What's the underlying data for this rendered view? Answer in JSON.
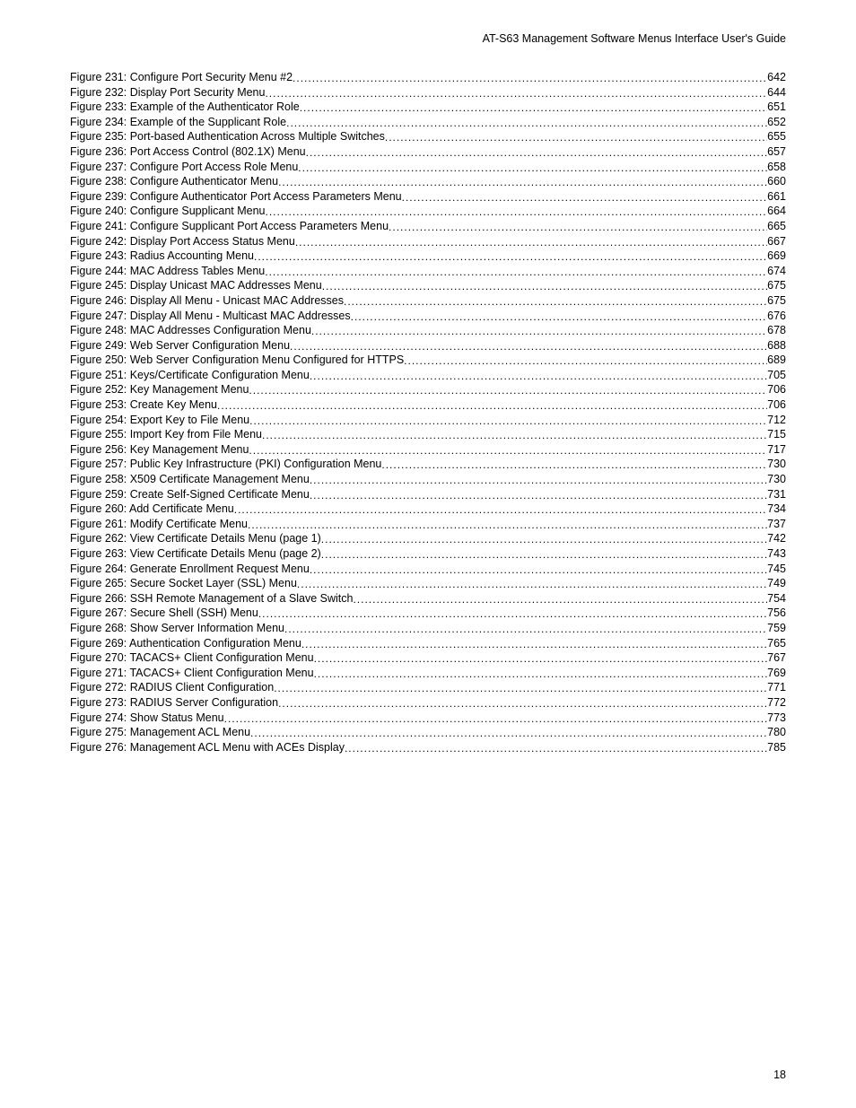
{
  "header": "AT-S63 Management Software Menus Interface User's Guide",
  "page_number": "18",
  "entries": [
    {
      "label": "Figure 231: Configure Port Security Menu #2",
      "page": "642"
    },
    {
      "label": "Figure 232: Display Port Security Menu",
      "page": "644"
    },
    {
      "label": "Figure 233: Example of the Authenticator Role",
      "page": "651"
    },
    {
      "label": "Figure 234: Example of the Supplicant Role",
      "page": "652"
    },
    {
      "label": "Figure 235: Port-based Authentication Across Multiple Switches",
      "page": "655"
    },
    {
      "label": "Figure 236: Port Access Control (802.1X) Menu",
      "page": "657"
    },
    {
      "label": "Figure 237: Configure Port Access Role Menu",
      "page": "658"
    },
    {
      "label": "Figure 238: Configure Authenticator Menu",
      "page": "660"
    },
    {
      "label": "Figure 239: Configure Authenticator Port Access Parameters Menu",
      "page": "661"
    },
    {
      "label": "Figure 240: Configure Supplicant Menu",
      "page": "664"
    },
    {
      "label": "Figure 241: Configure Supplicant Port Access Parameters Menu",
      "page": "665"
    },
    {
      "label": "Figure 242: Display Port Access Status Menu",
      "page": "667"
    },
    {
      "label": "Figure 243: Radius Accounting Menu",
      "page": "669"
    },
    {
      "label": "Figure 244: MAC Address Tables Menu",
      "page": "674"
    },
    {
      "label": "Figure 245: Display Unicast MAC Addresses Menu",
      "page": "675"
    },
    {
      "label": "Figure 246: Display All Menu - Unicast MAC Addresses",
      "page": "675"
    },
    {
      "label": "Figure 247: Display All Menu - Multicast MAC Addresses",
      "page": "676"
    },
    {
      "label": "Figure 248: MAC Addresses Configuration Menu",
      "page": "678"
    },
    {
      "label": "Figure 249: Web Server Configuration Menu",
      "page": "688"
    },
    {
      "label": "Figure 250: Web Server Configuration Menu Configured for HTTPS",
      "page": "689"
    },
    {
      "label": "Figure 251: Keys/Certificate Configuration Menu",
      "page": "705"
    },
    {
      "label": "Figure 252: Key Management Menu",
      "page": "706"
    },
    {
      "label": "Figure 253: Create Key Menu",
      "page": "706"
    },
    {
      "label": "Figure 254: Export Key to File Menu",
      "page": "712"
    },
    {
      "label": "Figure 255: Import Key from File Menu",
      "page": "715"
    },
    {
      "label": "Figure 256: Key Management Menu",
      "page": "717"
    },
    {
      "label": "Figure 257: Public Key Infrastructure (PKI) Configuration Menu",
      "page": "730"
    },
    {
      "label": "Figure 258: X509 Certificate Management Menu",
      "page": "730"
    },
    {
      "label": "Figure 259: Create Self-Signed Certificate Menu",
      "page": "731"
    },
    {
      "label": "Figure 260: Add Certificate Menu",
      "page": "734"
    },
    {
      "label": "Figure 261: Modify Certificate Menu",
      "page": "737"
    },
    {
      "label": "Figure 262: View Certificate Details Menu (page 1)",
      "page": "742"
    },
    {
      "label": "Figure 263: View Certificate Details Menu (page 2)",
      "page": "743"
    },
    {
      "label": "Figure 264: Generate Enrollment Request Menu",
      "page": "745"
    },
    {
      "label": "Figure 265: Secure Socket Layer (SSL) Menu",
      "page": "749"
    },
    {
      "label": "Figure 266: SSH Remote Management of a Slave Switch",
      "page": "754"
    },
    {
      "label": "Figure 267: Secure Shell (SSH) Menu",
      "page": "756"
    },
    {
      "label": "Figure 268: Show Server Information Menu",
      "page": "759"
    },
    {
      "label": "Figure 269: Authentication Configuration Menu",
      "page": "765"
    },
    {
      "label": "Figure 270: TACACS+ Client Configuration Menu",
      "page": "767"
    },
    {
      "label": "Figure 271: TACACS+ Client Configuration Menu",
      "page": "769"
    },
    {
      "label": "Figure 272: RADIUS Client Configuration",
      "page": "771"
    },
    {
      "label": "Figure 273: RADIUS Server Configuration",
      "page": "772"
    },
    {
      "label": "Figure 274: Show Status Menu",
      "page": "773"
    },
    {
      "label": "Figure 275: Management ACL Menu",
      "page": "780"
    },
    {
      "label": "Figure 276: Management ACL Menu with ACEs Display",
      "page": "785"
    }
  ]
}
